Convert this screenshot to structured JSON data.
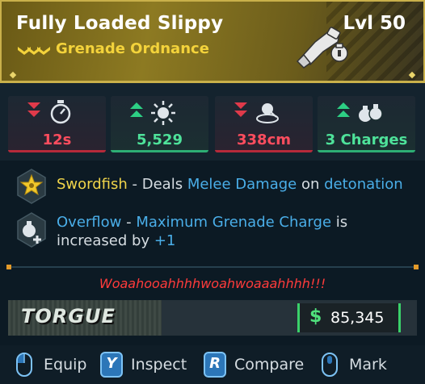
{
  "item": {
    "name": "Fully Loaded Slippy",
    "level": "Lvl 50",
    "type": "Grenade Ordnance",
    "rarity_color": "#f4d33b"
  },
  "stats": [
    {
      "value": "12s",
      "direction": "down",
      "icon": "stopwatch-icon",
      "status": "negative"
    },
    {
      "value": "5,529",
      "direction": "up",
      "icon": "damage-burst-icon",
      "status": "positive"
    },
    {
      "value": "338cm",
      "direction": "down",
      "icon": "radius-icon",
      "status": "negative"
    },
    {
      "value": "3 Charges",
      "direction": "up",
      "icon": "grenade-charges-icon",
      "status": "positive"
    }
  ],
  "perks": {
    "perk1": {
      "icon": "swordfish-star-icon",
      "name": "Swordfish",
      "sep": " - Deals ",
      "kw1": "Melee Damage",
      "mid": " on ",
      "kw2": "detonation"
    },
    "perk2": {
      "icon": "overflow-grenade-plus-icon",
      "name": "Overflow",
      "sep": " - ",
      "kw1": "Maximum Grenade Charge",
      "mid": " is increased by ",
      "kw2": "+1"
    }
  },
  "flavor_text": "Woaahooahhhhwoahwoaaahhhh!!!",
  "maker": {
    "name": "TORGUE"
  },
  "price": {
    "symbol": "$",
    "value": "85,345"
  },
  "actions": [
    {
      "label": "Equip",
      "key": ""
    },
    {
      "label": "Inspect",
      "key": "Y"
    },
    {
      "label": "Compare",
      "key": "R"
    },
    {
      "label": "Mark",
      "key": ""
    }
  ],
  "colors": {
    "negative": "#ff4d5e",
    "positive": "#4ee29a",
    "keyword": "#4aaee8",
    "perk_name": "#f0d44a",
    "flavor": "#ff3b3b",
    "price": "#4fe07c"
  }
}
